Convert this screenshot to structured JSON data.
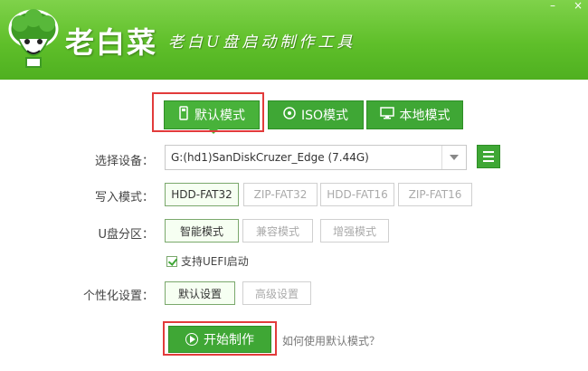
{
  "app": {
    "title": "老白菜",
    "slogan": "老白U盘启动制作工具",
    "minimize": "–",
    "close": "×"
  },
  "tabs": [
    {
      "label": "默认模式",
      "icon": "usb-icon"
    },
    {
      "label": "ISO模式",
      "icon": "disc-icon"
    },
    {
      "label": "本地模式",
      "icon": "monitor-icon"
    }
  ],
  "form": {
    "device_label": "选择设备：",
    "device_value": "G:(hd1)SanDiskCruzer_Edge (7.44G)",
    "write_label": "写入模式：",
    "write_options": [
      "HDD-FAT32",
      "ZIP-FAT32",
      "HDD-FAT16",
      "ZIP-FAT16"
    ],
    "partition_label": "U盘分区：",
    "partition_options": [
      "智能模式",
      "兼容模式",
      "增强模式"
    ],
    "uefi_label": "支持UEFI启动",
    "personal_label": "个性化设置：",
    "personal_options": [
      "默认设置",
      "高级设置"
    ]
  },
  "start_button": "开始制作",
  "help_link": "如何使用默认模式？",
  "colors": {
    "header_green": "#5fbf2a",
    "button_green": "#3fa735",
    "highlight_red": "#e23b3b"
  }
}
